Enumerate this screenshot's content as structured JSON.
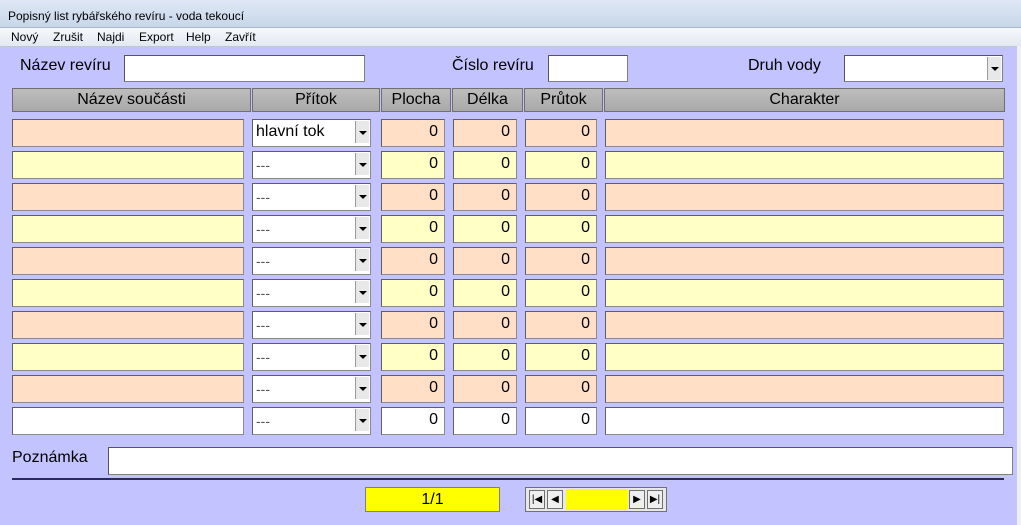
{
  "window": {
    "title": "Popisný list rybářského revíru - voda tekoucí"
  },
  "menu": [
    "Nový",
    "Zrušit",
    "Najdi",
    "Export",
    "Help",
    "Zavřít"
  ],
  "form": {
    "name_label": "Název revíru",
    "name_value": "",
    "number_label": "Číslo revíru",
    "number_value": "",
    "water_label": "Druh vody",
    "water_value": ""
  },
  "columns": [
    "Název součásti",
    "Přítok",
    "Plocha",
    "Délka",
    "Průtok",
    "Charakter"
  ],
  "rows": [
    {
      "name": "",
      "pritok": "hlavní tok",
      "plocha": "0",
      "delka": "0",
      "prutok": "0",
      "charakter": ""
    },
    {
      "name": "",
      "pritok": "---",
      "plocha": "0",
      "delka": "0",
      "prutok": "0",
      "charakter": ""
    },
    {
      "name": "",
      "pritok": "---",
      "plocha": "0",
      "delka": "0",
      "prutok": "0",
      "charakter": ""
    },
    {
      "name": "",
      "pritok": "---",
      "plocha": "0",
      "delka": "0",
      "prutok": "0",
      "charakter": ""
    },
    {
      "name": "",
      "pritok": "---",
      "plocha": "0",
      "delka": "0",
      "prutok": "0",
      "charakter": ""
    },
    {
      "name": "",
      "pritok": "---",
      "plocha": "0",
      "delka": "0",
      "prutok": "0",
      "charakter": ""
    },
    {
      "name": "",
      "pritok": "---",
      "plocha": "0",
      "delka": "0",
      "prutok": "0",
      "charakter": ""
    },
    {
      "name": "",
      "pritok": "---",
      "plocha": "0",
      "delka": "0",
      "prutok": "0",
      "charakter": ""
    },
    {
      "name": "",
      "pritok": "---",
      "plocha": "0",
      "delka": "0",
      "prutok": "0",
      "charakter": ""
    },
    {
      "name": "",
      "pritok": "---",
      "plocha": "0",
      "delka": "0",
      "prutok": "0",
      "charakter": ""
    }
  ],
  "note": {
    "label": "Poznámka",
    "value": ""
  },
  "record_counter": "1/1",
  "nav": {
    "first": "first-icon",
    "prev": "prev-icon",
    "next": "next-icon",
    "last": "last-icon"
  },
  "colors": {
    "background": "#c3c3ff",
    "row_odd": "#ffdfc6",
    "row_even": "#ffffc6",
    "counter": "#ffff00"
  }
}
